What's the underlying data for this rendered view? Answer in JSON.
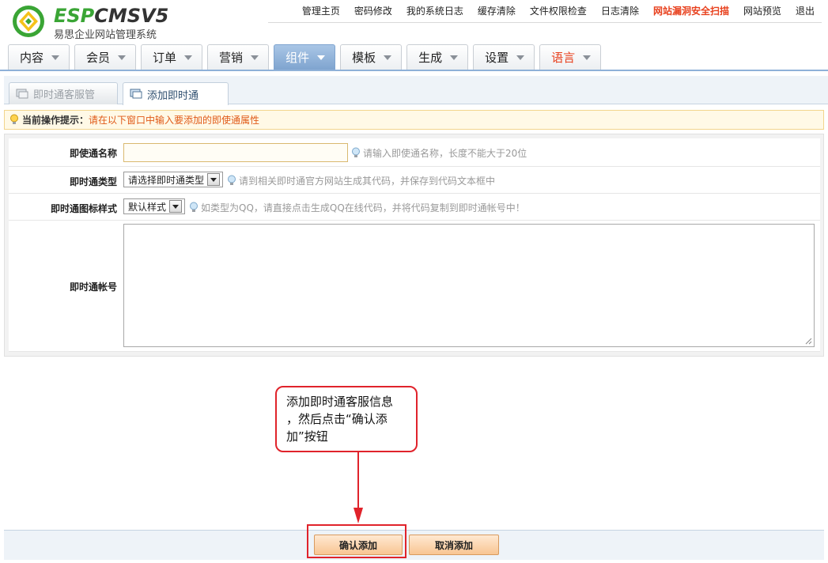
{
  "logo": {
    "brand_green": "ESP",
    "brand_dark": "CMS",
    "brand_version": "V5",
    "subtitle": "易思企业网站管理系统"
  },
  "topnav": [
    {
      "label": "管理主页"
    },
    {
      "label": "密码修改"
    },
    {
      "label": "我的系统日志"
    },
    {
      "label": "缓存清除"
    },
    {
      "label": "文件权限检查"
    },
    {
      "label": "日志清除"
    },
    {
      "label": "网站漏洞安全扫描"
    },
    {
      "label": "网站预览"
    },
    {
      "label": "退出"
    }
  ],
  "mainnav": [
    {
      "label": "内容"
    },
    {
      "label": "会员"
    },
    {
      "label": "订单"
    },
    {
      "label": "营销"
    },
    {
      "label": "组件"
    },
    {
      "label": "模板"
    },
    {
      "label": "生成"
    },
    {
      "label": "设置"
    },
    {
      "label": "语言"
    }
  ],
  "subtabs": [
    {
      "label": "即时通客服管"
    },
    {
      "label": "添加即时通"
    }
  ],
  "tip": {
    "label": "当前操作提示：",
    "text": "请在以下窗口中输入要添加的即使通属性"
  },
  "form": {
    "name_label": "即使通名称",
    "name_value": "",
    "name_hint": "请输入即使通名称，长度不能大于20位",
    "type_label": "即时通类型",
    "type_value": "请选择即时通类型",
    "type_hint": "请到相关即时通官方网站生成其代码，并保存到代码文本框中",
    "style_label": "即时通图标样式",
    "style_value": "默认样式",
    "style_hint": "如类型为QQ，请直接点击生成QQ在线代码，并将代码复制到即时通帐号中！",
    "account_label": "即时通帐号"
  },
  "callout": {
    "line1": "添加即时通客服信息",
    "line2": "，然后点击“确认添",
    "line3": "加”按钮"
  },
  "buttons": {
    "ok": "确认添加",
    "cancel": "取消添加"
  },
  "colors": {
    "accent_blue": "#7fa4cf",
    "warning_red": "#e8411e",
    "annotation_red": "#e0232b",
    "button_orange": "#f8c592"
  }
}
